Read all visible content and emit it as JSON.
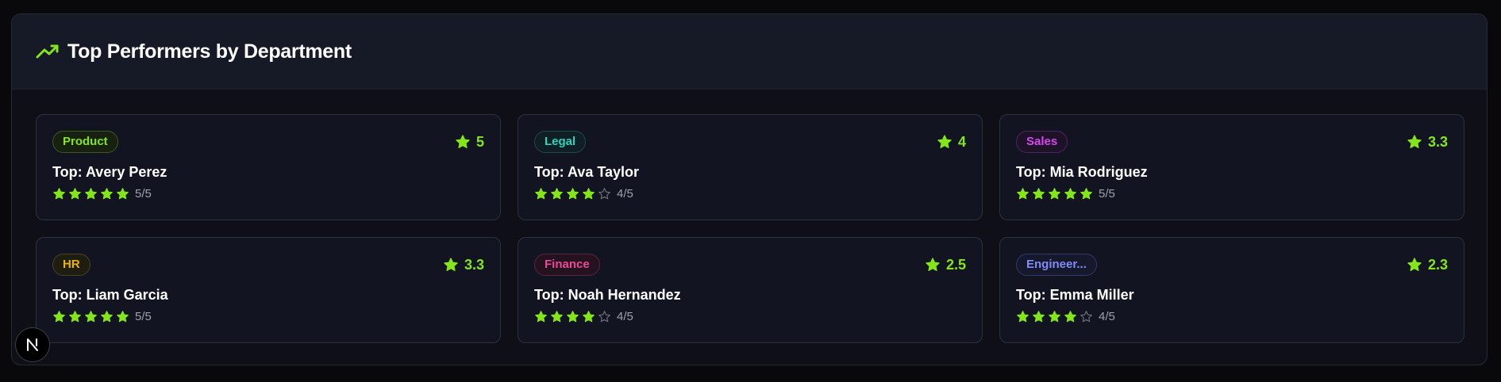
{
  "header": {
    "title": "Top Performers by Department",
    "icon": "trending-up-icon",
    "icon_color": "#84e61a"
  },
  "colors": {
    "accent": "#84e61a",
    "star_empty": "#71717a"
  },
  "cards": [
    {
      "department": "Product",
      "score": "5",
      "top_label": "Top: Avery Perez",
      "rating": 5,
      "rating_text": "5/5",
      "badge_color": "#84e61a",
      "badge_bg": "#17210f",
      "badge_border": "#3f5a1c"
    },
    {
      "department": "Legal",
      "score": "4",
      "top_label": "Top: Ava Taylor",
      "rating": 4,
      "rating_text": "4/5",
      "badge_color": "#2dd4bf",
      "badge_bg": "#0f1f24",
      "badge_border": "#1f4a4a"
    },
    {
      "department": "Sales",
      "score": "3.3",
      "top_label": "Top: Mia Rodriguez",
      "rating": 5,
      "rating_text": "5/5",
      "badge_color": "#d946ef",
      "badge_bg": "#1e1229",
      "badge_border": "#4a2660"
    },
    {
      "department": "HR",
      "score": "3.3",
      "top_label": "Top: Liam Garcia",
      "rating": 5,
      "rating_text": "5/5",
      "badge_color": "#eab308",
      "badge_bg": "#1f1c10",
      "badge_border": "#4a4220"
    },
    {
      "department": "Finance",
      "score": "2.5",
      "top_label": "Top: Noah Hernandez",
      "rating": 4,
      "rating_text": "4/5",
      "badge_color": "#ec4899",
      "badge_bg": "#24121f",
      "badge_border": "#5a2445"
    },
    {
      "department": "Engineer...",
      "score": "2.3",
      "top_label": "Top: Emma Miller",
      "rating": 4,
      "rating_text": "4/5",
      "badge_color": "#818cf8",
      "badge_bg": "#16182c",
      "badge_border": "#33386a"
    }
  ],
  "floating_badge": {
    "letter": "N"
  }
}
